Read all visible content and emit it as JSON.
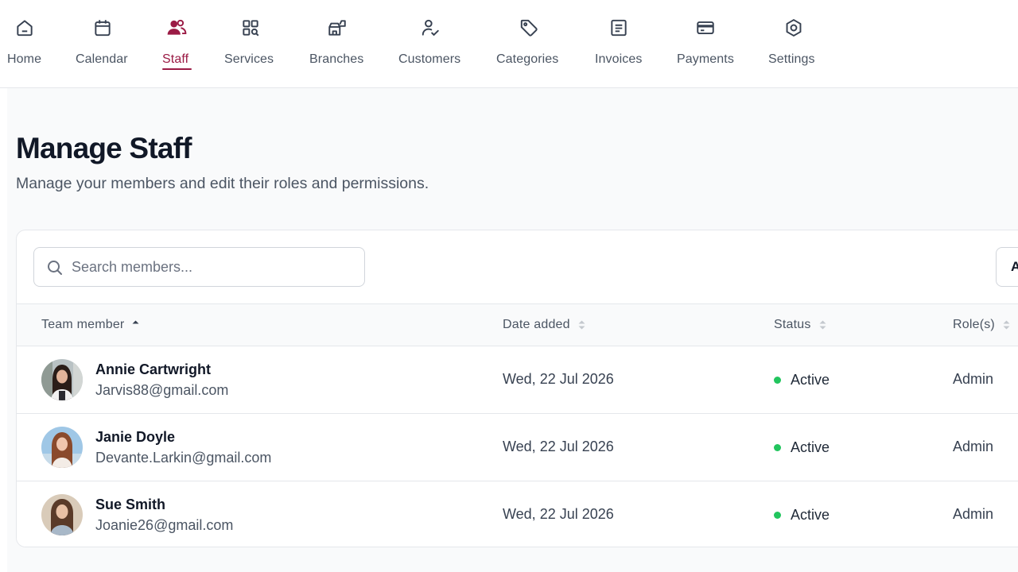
{
  "nav": {
    "items": [
      {
        "label": "Home",
        "icon": "home-icon"
      },
      {
        "label": "Calendar",
        "icon": "calendar-icon"
      },
      {
        "label": "Staff",
        "icon": "staff-icon",
        "active": true
      },
      {
        "label": "Services",
        "icon": "services-icon"
      },
      {
        "label": "Branches",
        "icon": "branches-icon"
      },
      {
        "label": "Customers",
        "icon": "customers-icon"
      },
      {
        "label": "Categories",
        "icon": "tag-icon"
      },
      {
        "label": "Invoices",
        "icon": "invoice-icon"
      },
      {
        "label": "Payments",
        "icon": "card-icon"
      },
      {
        "label": "Settings",
        "icon": "gear-icon"
      }
    ]
  },
  "page": {
    "title": "Manage Staff",
    "subtitle": "Manage your members and edit their roles and permissions."
  },
  "toolbar": {
    "search_placeholder": "Search members...",
    "search_value": "",
    "add_label": "A"
  },
  "table": {
    "columns": [
      {
        "label": "Team member",
        "sort": "asc"
      },
      {
        "label": "Date added",
        "sort": "none"
      },
      {
        "label": "Status",
        "sort": "none"
      },
      {
        "label": "Role(s)",
        "sort": "none"
      }
    ],
    "rows": [
      {
        "name": "Annie Cartwright",
        "email": "Jarvis88@gmail.com",
        "date_added": "Wed, 22 Jul 2026",
        "status": "Active",
        "role": "Admin"
      },
      {
        "name": "Janie Doyle",
        "email": "Devante.Larkin@gmail.com",
        "date_added": "Wed, 22 Jul 2026",
        "status": "Active",
        "role": "Admin"
      },
      {
        "name": "Sue Smith",
        "email": "Joanie26@gmail.com",
        "date_added": "Wed, 22 Jul 2026",
        "status": "Active",
        "role": "Admin"
      }
    ]
  },
  "colors": {
    "accent": "#9b1b45",
    "status_active": "#22c55e",
    "nav_text": "#4b5563"
  }
}
